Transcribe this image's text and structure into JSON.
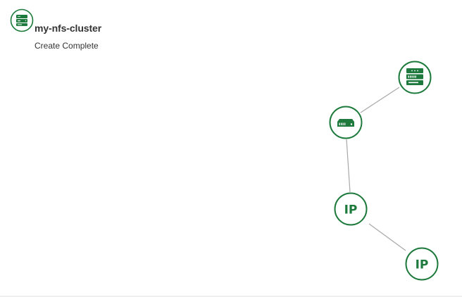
{
  "stack": {
    "name": "my-nfs-cluster",
    "status": "Create Complete",
    "icon": "server-stack-icon"
  },
  "topology": {
    "accent_color": "#1d7a3c",
    "edge_color": "#a8a8a8",
    "nodes": [
      {
        "id": "instance",
        "icon": "server-rack-icon"
      },
      {
        "id": "volume",
        "icon": "storage-volume-icon"
      },
      {
        "id": "ip-1",
        "icon": "ip-address-icon",
        "label": "IP"
      },
      {
        "id": "ip-2",
        "icon": "ip-address-icon",
        "label": "IP"
      }
    ],
    "edges": [
      [
        "instance",
        "volume"
      ],
      [
        "volume",
        "ip-1"
      ],
      [
        "ip-1",
        "ip-2"
      ]
    ]
  }
}
